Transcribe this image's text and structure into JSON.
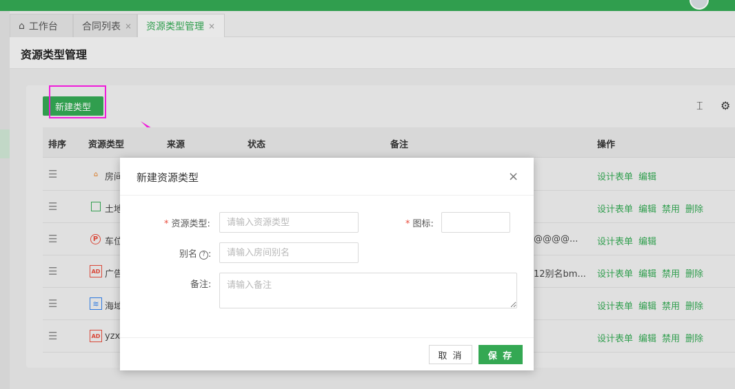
{
  "header": {
    "avatar_icon": "user-avatar-icon"
  },
  "tabs": [
    {
      "label": "工作台",
      "icon": "home-icon"
    },
    {
      "label": "合同列表",
      "close": "×"
    },
    {
      "label": "资源类型管理",
      "close": "×"
    }
  ],
  "page": {
    "title": "资源类型管理"
  },
  "toolbar": {
    "new_label": "新建类型",
    "column_icon": "column-height-icon",
    "settings_icon": "gear-icon"
  },
  "table": {
    "columns": [
      "排序",
      "资源类型",
      "来源",
      "状态",
      "备注",
      "操作"
    ],
    "rows": [
      {
        "name": "房间",
        "icon": "house-icon",
        "remark": "",
        "ops": [
          "设计表单",
          "编辑"
        ]
      },
      {
        "name": "土地",
        "icon": "layout-icon",
        "remark": "",
        "ops": [
          "设计表单",
          "编辑",
          "禁用",
          "删除"
        ]
      },
      {
        "name": "车位",
        "icon": "parking-icon",
        "remark": "@@@@...",
        "ops": [
          "设计表单",
          "编辑"
        ]
      },
      {
        "name": "广告",
        "icon": "ad-icon",
        "remark": "12别名bm...",
        "ops": [
          "设计表单",
          "编辑",
          "禁用",
          "删除"
        ]
      },
      {
        "name": "海域",
        "icon": "water-icon",
        "remark": "",
        "ops": [
          "设计表单",
          "编辑",
          "禁用",
          "删除"
        ]
      },
      {
        "name": "yzx",
        "icon": "ad-icon",
        "remark": "",
        "ops": [
          "设计表单",
          "编辑",
          "禁用",
          "删除"
        ]
      }
    ]
  },
  "dialog": {
    "title": "新建资源类型",
    "close": "×",
    "fields": {
      "type_label": "资源类型:",
      "type_placeholder": "请输入资源类型",
      "icon_label": "图标:",
      "alias_label": "别名",
      "alias_colon": ":",
      "alias_placeholder": "请输入房间别名",
      "remark_label": "备注:",
      "remark_placeholder": "请输入备注"
    },
    "cancel_label": "取 消",
    "save_label": "保 存"
  },
  "colors": {
    "accent": "#34a853",
    "annotation": "#ff1ee8",
    "required": "#e94b3c"
  }
}
